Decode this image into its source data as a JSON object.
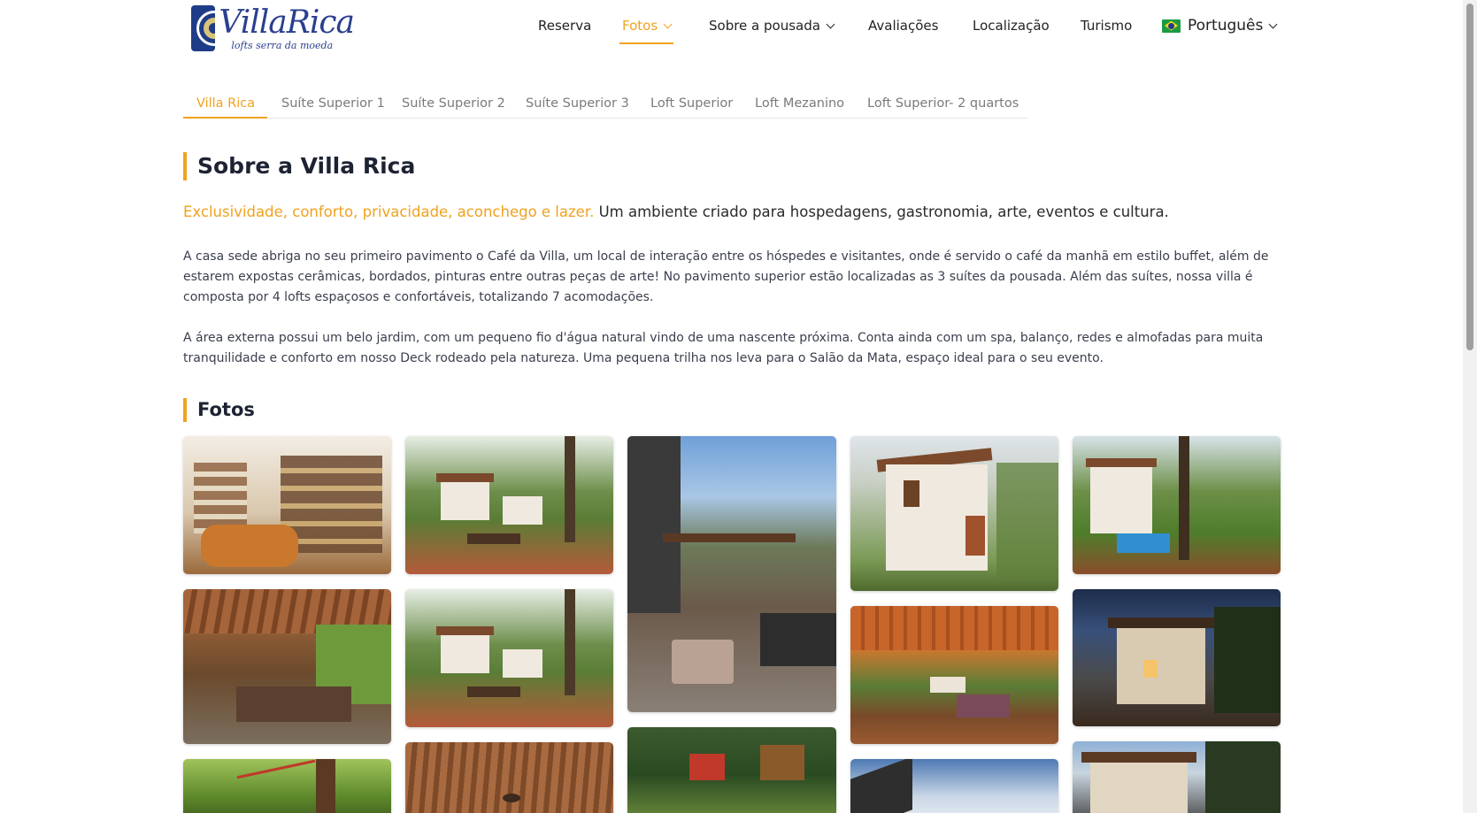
{
  "header": {
    "logo": {
      "name": "VillaRica",
      "tagline": "lofts serra da moeda"
    },
    "nav": [
      {
        "label": "Reserva",
        "has_dropdown": false,
        "active": false
      },
      {
        "label": "Fotos",
        "has_dropdown": true,
        "active": true
      },
      {
        "label": "Sobre a pousada",
        "has_dropdown": true,
        "active": false
      },
      {
        "label": "Avaliações",
        "has_dropdown": false,
        "active": false
      },
      {
        "label": "Localização",
        "has_dropdown": false,
        "active": false
      },
      {
        "label": "Turismo",
        "has_dropdown": false,
        "active": false
      }
    ],
    "language": {
      "label": "Português",
      "flag_icon": "brazil-flag-icon"
    }
  },
  "tabs": [
    {
      "label": "Villa Rica",
      "active": true
    },
    {
      "label": "Suíte Superior 1",
      "active": false
    },
    {
      "label": "Suíte Superior 2",
      "active": false
    },
    {
      "label": "Suíte Superior 3",
      "active": false
    },
    {
      "label": "Loft Superior",
      "active": false
    },
    {
      "label": "Loft Mezanino",
      "active": false
    },
    {
      "label": "Loft Superior- 2 quartos",
      "active": false
    }
  ],
  "about": {
    "title": "Sobre a Villa Rica",
    "lead_highlight": "Exclusividade, conforto, privacidade, aconchego e lazer.",
    "lead_rest": " Um ambiente criado para hospedagens, gastronomia, arte, eventos e cultura.",
    "paragraphs": [
      "A casa sede abriga no seu primeiro pavimento o Café da Villa, um local de interação entre os hóspedes e visitantes, onde é servido o café da manhã em estilo buffet, além de estarem expostas cerâmicas, bordados, pinturas entre outras peças de arte! No pavimento superior estão localizadas as 3 suítes da pousada. Além das suítes, nossa villa é composta por 4 lofts espaçosos e confortáveis, totalizando 7 acomodações.",
      "A área externa possui um belo jardim, com um pequeno fio d'água natural vindo de uma nascente próxima. Conta ainda com um spa, balanço, redes e almofadas para muita tranquilidade e conforto em nosso Deck rodeado pela natureza. Uma pequena trilha nos leva para o Salão da Mata, espaço ideal para o seu evento."
    ]
  },
  "gallery": {
    "title": "Fotos",
    "accent_color": "#f0a21f"
  }
}
